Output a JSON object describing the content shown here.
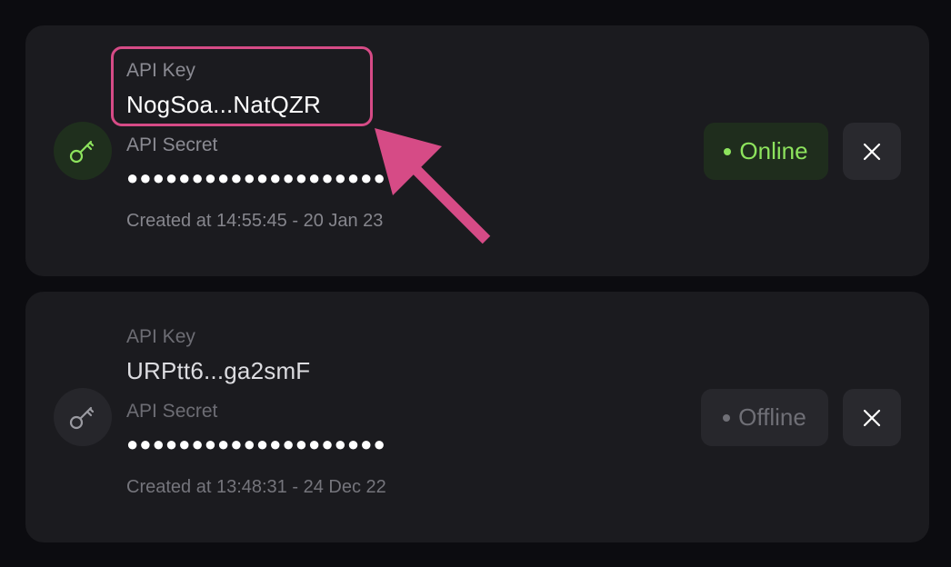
{
  "colors": {
    "background": "#0c0c10",
    "card": "#1b1b1f",
    "online": "#8de35d",
    "offline": "#6f6f76",
    "annotation": "#d64b86"
  },
  "keys": [
    {
      "icon": "key-icon",
      "key_label": "API Key",
      "key_value": "NogSoa...NatQZR",
      "secret_label": "API Secret",
      "secret_value": "●●●●●●●●●●●●●●●●●●●●",
      "created": "Created at 14:55:45 - 20 Jan 23",
      "status": "Online",
      "close_icon": "close-icon"
    },
    {
      "icon": "key-icon",
      "key_label": "API Key",
      "key_value": "URPtt6...ga2smF",
      "secret_label": "API Secret",
      "secret_value": "●●●●●●●●●●●●●●●●●●●●",
      "created": "Created at 13:48:31 - 24 Dec 22",
      "status": "Offline",
      "close_icon": "close-icon"
    }
  ],
  "annotation": {
    "highlight": "api-key-value",
    "arrow_icon": "arrow-icon"
  }
}
